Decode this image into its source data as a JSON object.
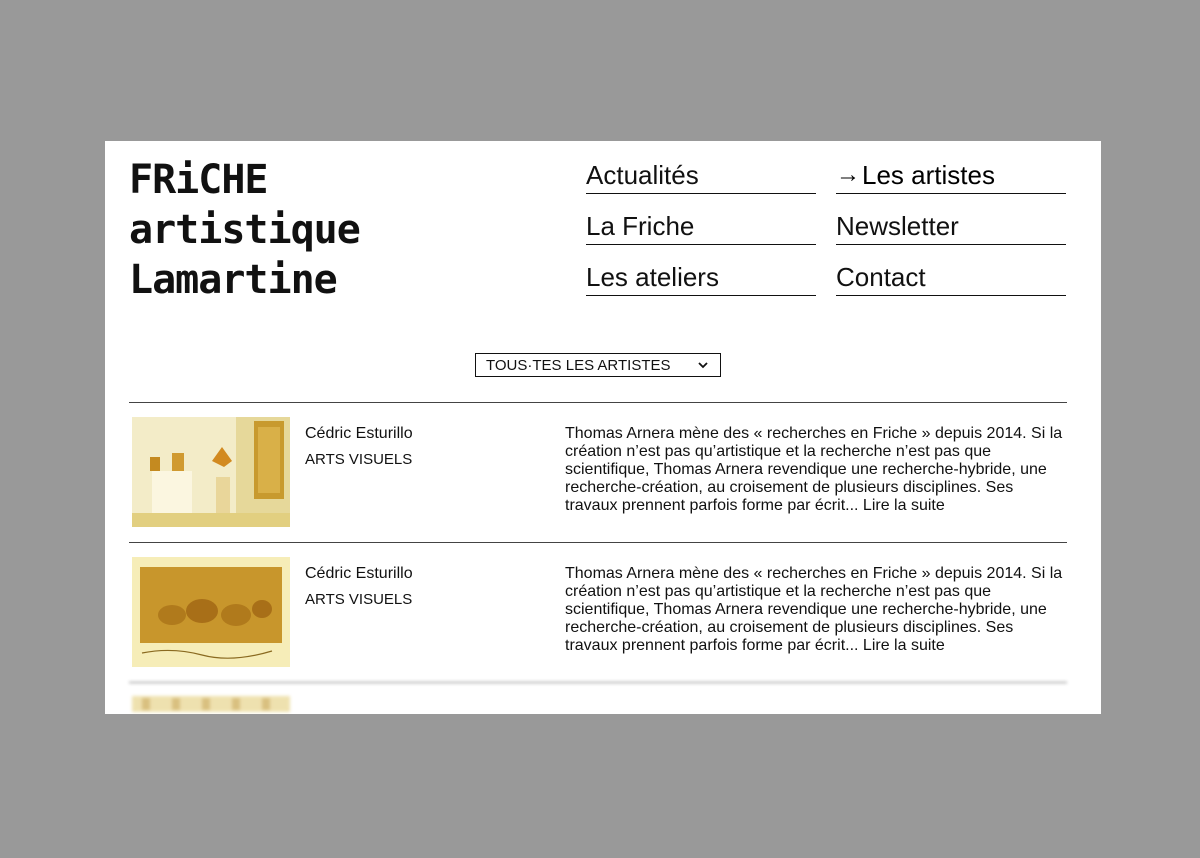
{
  "logo": {
    "lines": [
      "FRiCHE",
      "artistique",
      "Lamartine"
    ]
  },
  "nav": [
    {
      "label": "Actualités"
    },
    {
      "label": "Les artistes",
      "active": true
    },
    {
      "label": "La Friche"
    },
    {
      "label": "Newsletter"
    },
    {
      "label": "Les ateliers"
    },
    {
      "label": "Contact"
    }
  ],
  "filter": {
    "label": "TOUS·TES LES ARTISTES",
    "icon": "chevron-down-icon"
  },
  "artists": [
    {
      "name": "Cédric Esturillo",
      "category": "ARTS VISUELS",
      "description": "Thomas Arnera mène des « recherches en Friche » depuis 2014. Si la création n’est pas qu’artistique et la recherche n’est pas que scientifique, Thomas Arnera revendique une recherche-hybride, une recherche-création, au croisement de plusieurs disciplines. Ses travaux prennent parfois forme par écrit...",
      "more": "Lire la suite"
    },
    {
      "name": "Cédric Esturillo",
      "category": "ARTS VISUELS",
      "description": "Thomas Arnera mène des « recherches en Friche » depuis 2014. Si la création n’est pas qu’artistique et la recherche n’est pas que scientifique, Thomas Arnera revendique une recherche-hybride, une recherche-création, au croisement de plusieurs disciplines. Ses travaux prennent parfois forme par écrit...",
      "more": "Lire la suite"
    }
  ],
  "colors": {
    "background": "#999999",
    "page": "#ffffff",
    "text": "#111111",
    "thumb_tint": "#e8c860"
  }
}
